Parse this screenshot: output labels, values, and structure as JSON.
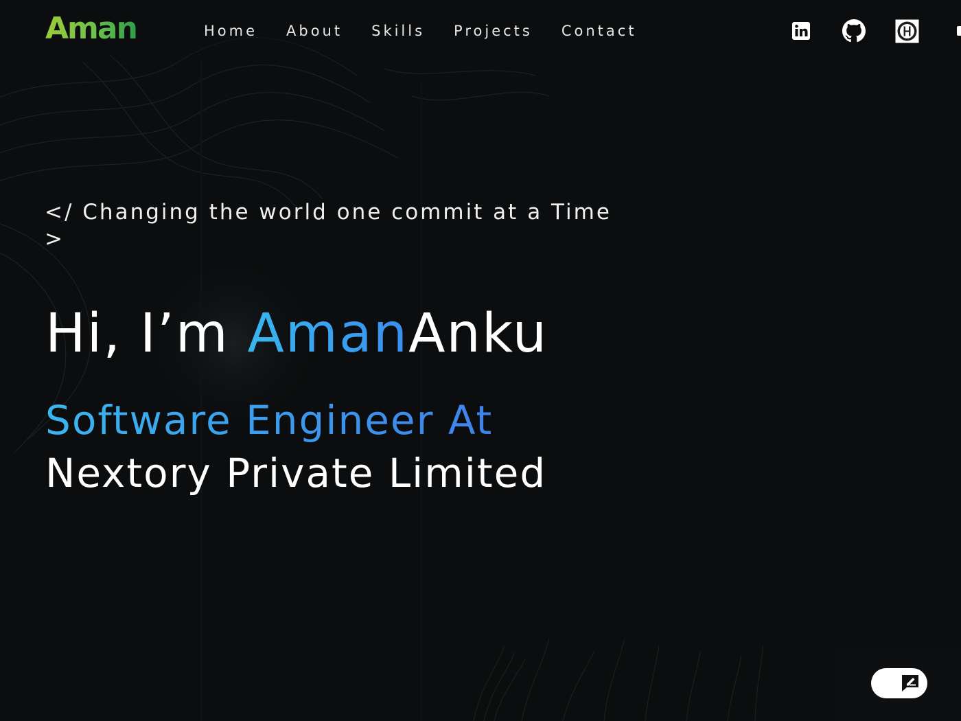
{
  "header": {
    "logo": "Aman",
    "nav": [
      {
        "label": "Home"
      },
      {
        "label": "About"
      },
      {
        "label": "Skills"
      },
      {
        "label": "Projects"
      },
      {
        "label": "Contact"
      }
    ],
    "social": [
      {
        "icon": "linkedin-icon"
      },
      {
        "icon": "github-icon"
      },
      {
        "icon": "hashnode-icon"
      }
    ]
  },
  "hero": {
    "tagline": "</ Changing the world one commit at a Time >",
    "greeting_prefix": "Hi, I’m ",
    "first_name": "Aman",
    "last_name": "Anku",
    "role_accent": "Software Engineer At",
    "company": "Nextory Private Limited"
  },
  "feedback": {
    "icon": "feedback-icon"
  },
  "colors": {
    "background": "#0b0d0e",
    "logo_green": "#7fc241",
    "accent_blue": "#39b6ee",
    "accent_blue_deep": "#3f82ec",
    "text": "#ffffff"
  }
}
